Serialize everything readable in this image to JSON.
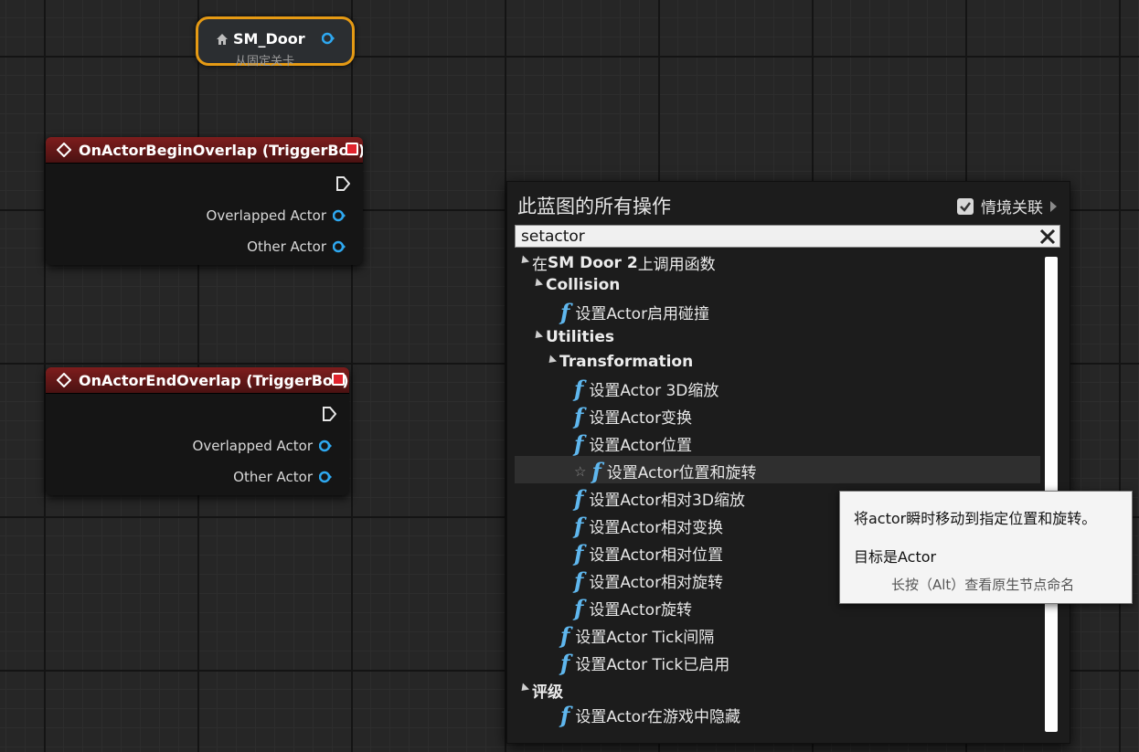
{
  "ref_node": {
    "title": "SM_Door",
    "subtitle": "从固定关卡"
  },
  "begin_node": {
    "title": "OnActorBeginOverlap (TriggerBox)",
    "pin1": "Overlapped Actor",
    "pin2": "Other Actor"
  },
  "end_node": {
    "title": "OnActorEndOverlap (TriggerBox)",
    "pin1": "Overlapped Actor",
    "pin2": "Other Actor"
  },
  "panel": {
    "title": "此蓝图的所有操作",
    "context_label": "情境关联",
    "context_checked": true,
    "search_value": "setactor",
    "items": [
      {
        "label_prefix": "在 ",
        "label_bold": "SM Door 2",
        "label_suffix": "上调用函数",
        "kind": "root"
      },
      {
        "label": "Collision",
        "kind": "cat"
      },
      {
        "label": "设置Actor启用碰撞",
        "kind": "func"
      },
      {
        "label": "Utilities",
        "kind": "cat"
      },
      {
        "label": "Transformation",
        "kind": "cat"
      },
      {
        "label": "设置Actor 3D缩放",
        "kind": "func"
      },
      {
        "label": "设置Actor变换",
        "kind": "func"
      },
      {
        "label": "设置Actor位置",
        "kind": "func"
      },
      {
        "label": "设置Actor位置和旋转",
        "kind": "func",
        "selected": true
      },
      {
        "label": "设置Actor相对3D缩放",
        "kind": "func"
      },
      {
        "label": "设置Actor相对变换",
        "kind": "func"
      },
      {
        "label": "设置Actor相对位置",
        "kind": "func"
      },
      {
        "label": "设置Actor相对旋转",
        "kind": "func"
      },
      {
        "label": "设置Actor旋转",
        "kind": "func"
      },
      {
        "label": "设置Actor Tick间隔",
        "kind": "func"
      },
      {
        "label": "设置Actor Tick已启用",
        "kind": "func"
      },
      {
        "label": "评级",
        "kind": "cat"
      },
      {
        "label": "设置Actor在游戏中隐藏",
        "kind": "func"
      }
    ]
  },
  "tooltip": {
    "line1": "将actor瞬时移动到指定位置和旋转。",
    "line2": "目标是Actor",
    "line3": "长按（Alt）查看原生节点命名"
  },
  "colors": {
    "func_icon": "#5fb7ee",
    "pin": "#2ea8f0",
    "event_header": "#7e1d1d",
    "ref_border": "#e59a14"
  }
}
